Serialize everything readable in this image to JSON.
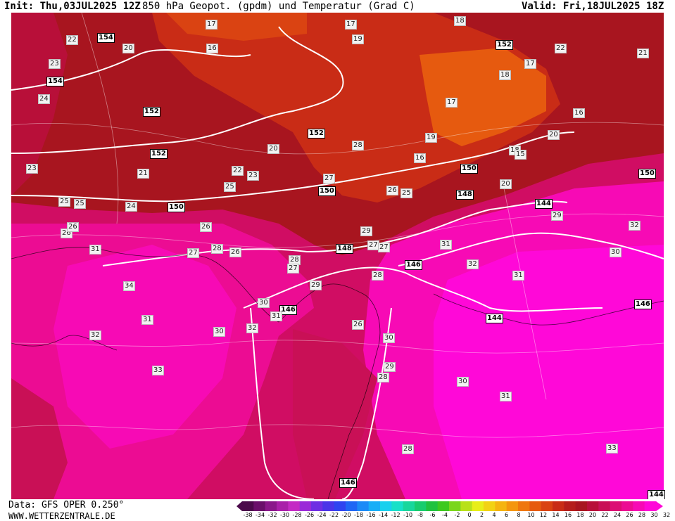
{
  "header": {
    "init": "Init: Thu,03JUL2025 12Z",
    "title": "850 hPa Geopot. (gpdm) und Temperatur (Grad C)",
    "valid": "Valid: Fri,18JUL2025 18Z"
  },
  "footer": {
    "data_source": "Data: GFS OPER 0.250°",
    "website": "WWW.WETTERZENTRALE.DE"
  },
  "colorbar": {
    "ticks": [
      "-38",
      "-34",
      "-32",
      "-30",
      "-28",
      "-26",
      "-24",
      "-22",
      "-20",
      "-18",
      "-16",
      "-14",
      "-12",
      "-10",
      "-8",
      "-6",
      "-4",
      "-2",
      "0",
      "2",
      "4",
      "6",
      "8",
      "10",
      "12",
      "14",
      "16",
      "18",
      "20",
      "22",
      "24",
      "26",
      "28",
      "30",
      "32"
    ],
    "colors": [
      "#4b0a4b",
      "#6a0f6a",
      "#8a178a",
      "#a91fa9",
      "#c42ac4",
      "#9a2ad8",
      "#6f2fe3",
      "#4b35e8",
      "#2f44f0",
      "#1f66f5",
      "#1c8af7",
      "#18aef7",
      "#18d0ee",
      "#18e0c8",
      "#18d79c",
      "#18cc6e",
      "#20c23f",
      "#3dc91f",
      "#7ad61c",
      "#b8e11a",
      "#e8ee18",
      "#f2d214",
      "#f5b411",
      "#f4960f",
      "#ef770e",
      "#e65a0f",
      "#da4312",
      "#c92c16",
      "#b51d1b",
      "#a8151f",
      "#b80f39",
      "#c91056",
      "#dc0e74",
      "#ec0c93",
      "#f70ab5",
      "#ff08d8"
    ]
  },
  "map": {
    "geopotential_labels": [
      "154",
      "154",
      "152",
      "152",
      "152",
      "150",
      "150",
      "150",
      "150",
      "148",
      "148",
      "146",
      "146",
      "146",
      "146",
      "144",
      "144",
      "144",
      "152"
    ],
    "temperature_labels": [
      "17",
      "17",
      "16",
      "19",
      "18",
      "20",
      "22",
      "22",
      "21",
      "23",
      "24",
      "23",
      "21",
      "20",
      "22",
      "23",
      "25",
      "26",
      "24",
      "25",
      "25",
      "26",
      "26",
      "27",
      "28",
      "26",
      "28",
      "27",
      "29",
      "30",
      "31",
      "32",
      "30",
      "31",
      "32",
      "33",
      "34",
      "31",
      "29",
      "28",
      "27",
      "26",
      "25",
      "19",
      "16",
      "17",
      "18",
      "17",
      "16",
      "20",
      "18",
      "15",
      "20",
      "27",
      "27",
      "26",
      "28",
      "29",
      "28",
      "28",
      "31",
      "32",
      "31",
      "30",
      "29",
      "30",
      "30",
      "32",
      "31",
      "33"
    ]
  }
}
